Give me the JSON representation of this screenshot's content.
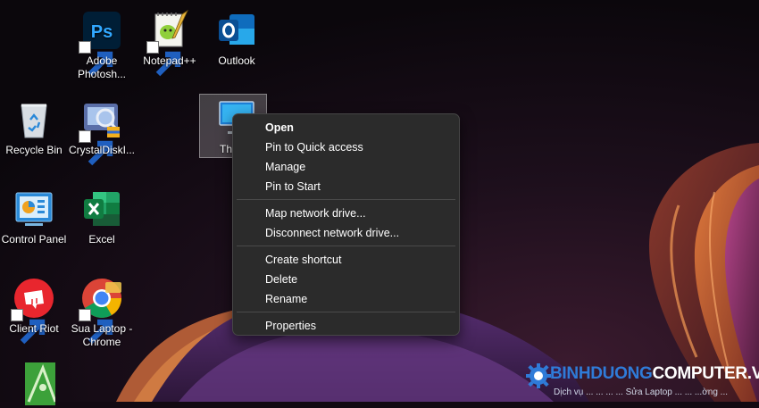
{
  "desktop": {
    "icons": [
      {
        "label": "Adobe Photosh...",
        "icon": "photoshop-icon",
        "shortcut": true
      },
      {
        "label": "Notepad++",
        "icon": "notepad-plus-plus-icon",
        "shortcut": true
      },
      {
        "label": "Outlook",
        "icon": "outlook-icon",
        "shortcut": false
      },
      {
        "label": "Recycle Bin",
        "icon": "recycle-bin-icon",
        "shortcut": false
      },
      {
        "label": "CrystalDiskI...",
        "icon": "crystaldiskinfo-icon",
        "shortcut": true
      },
      {
        "label": "Th",
        "icon": "monitor-icon",
        "shortcut": false
      },
      {
        "label": "Control Panel",
        "icon": "control-panel-icon",
        "shortcut": false
      },
      {
        "label": "Excel",
        "icon": "excel-icon",
        "shortcut": false
      },
      {
        "label": "Client Riot",
        "icon": "riot-client-icon",
        "shortcut": true
      },
      {
        "label": "Sua Laptop - Chrome",
        "icon": "chrome-icon",
        "shortcut": true
      },
      {
        "label": "",
        "icon": "coreldraw-icon",
        "shortcut": false
      }
    ]
  },
  "context_menu": {
    "items": [
      {
        "label": "Open",
        "bold": true
      },
      {
        "label": "Pin to Quick access"
      },
      {
        "label": "Manage"
      },
      {
        "label": "Pin to Start"
      },
      {
        "label": "Map network drive..."
      },
      {
        "label": "Disconnect network drive..."
      },
      {
        "label": "Create shortcut"
      },
      {
        "label": "Delete"
      },
      {
        "label": "Rename"
      },
      {
        "label": "Properties"
      }
    ]
  },
  "watermark": {
    "brand_part1": "BINHDUONG",
    "brand_part2": "COMPUTER.VN",
    "tagline": "Dịch vụ ... ... ... ... Sửa Laptop ... ... ...ờng ...",
    "colors": {
      "brand_part1": "#2f7bd8",
      "brand_part2": "#ffffff",
      "gear": "#2f7bd8"
    }
  },
  "colors": {
    "menu_bg": "#2b2b2b",
    "menu_separator": "#4a4a4a",
    "selection": "#ffffff"
  }
}
